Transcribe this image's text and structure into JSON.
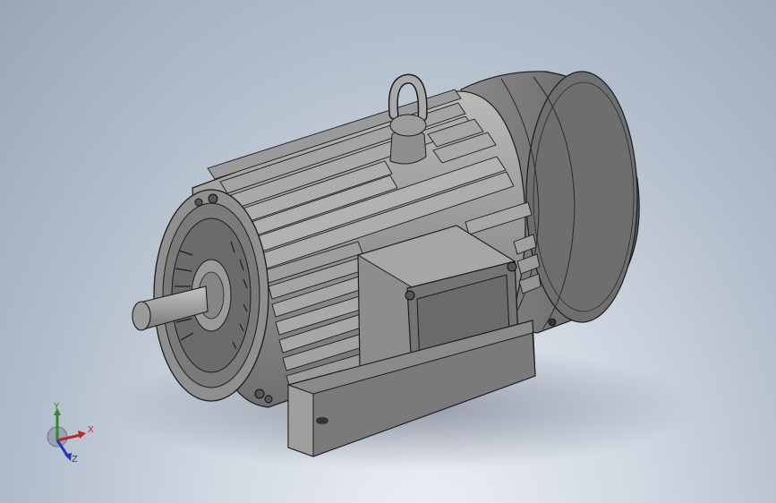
{
  "viewport": {
    "name": "3d-model-viewport",
    "model": "three-phase-induction-motor"
  },
  "triad": {
    "x_label": "X",
    "y_label": "Y",
    "z_label": "Z",
    "x_color": "#c0282c",
    "y_color": "#2c8a2c",
    "z_color": "#2a34b0"
  },
  "colors": {
    "metal_light": "#a7a7a7",
    "metal_mid": "#8c8c8c",
    "metal_dark": "#5e5e5e",
    "edge": "#1c1c1c"
  }
}
